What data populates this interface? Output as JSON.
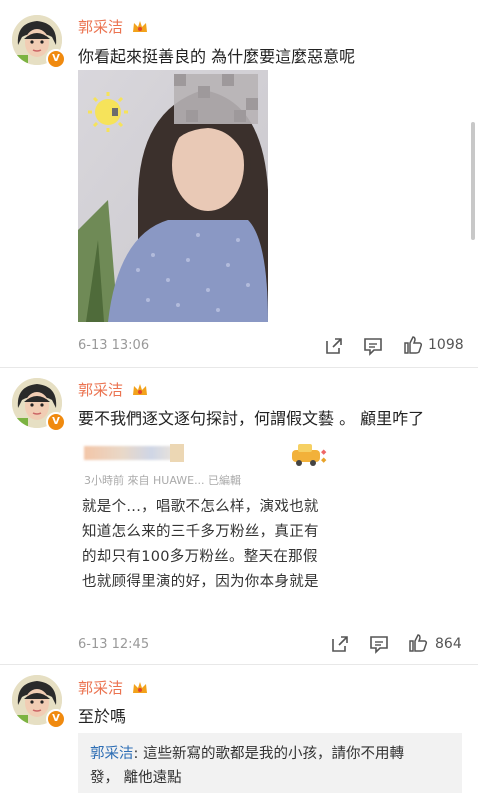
{
  "posts": [
    {
      "username": "郭采洁",
      "text": "你看起來挺善良的 為什麼要這麼惡意呢",
      "time": "6-13 13:06",
      "likes": "1098"
    },
    {
      "username": "郭采洁",
      "text": "要不我們逐文逐句探討，何謂假文藝 。 顧里咋了",
      "time": "6-13 12:45",
      "likes": "864",
      "embedded": {
        "meta": "3小時前  來自 HUAWE...  已編輯",
        "lines": [
          "就是个...，唱歌不怎么样，演戏也就",
          "知道怎么来的三千多万粉丝，真正有",
          "的却只有100多万粉丝。整天在那假",
          "也就顾得里演的好，因为你本身就是"
        ]
      }
    },
    {
      "username": "郭采洁",
      "text": "至於嗎",
      "quote": {
        "name": "郭采洁",
        "line1": ": 這些新寫的歌都是我的小孩，請你不用轉",
        "line2": "發， 離他遠點"
      }
    }
  ],
  "colors": {
    "username": "#eb7350",
    "quote_name": "#2f6fb5",
    "badge": "#f08a0f"
  },
  "icons": [
    "share-icon",
    "comment-icon",
    "like-icon",
    "verified-badge-icon",
    "crown-icon"
  ]
}
